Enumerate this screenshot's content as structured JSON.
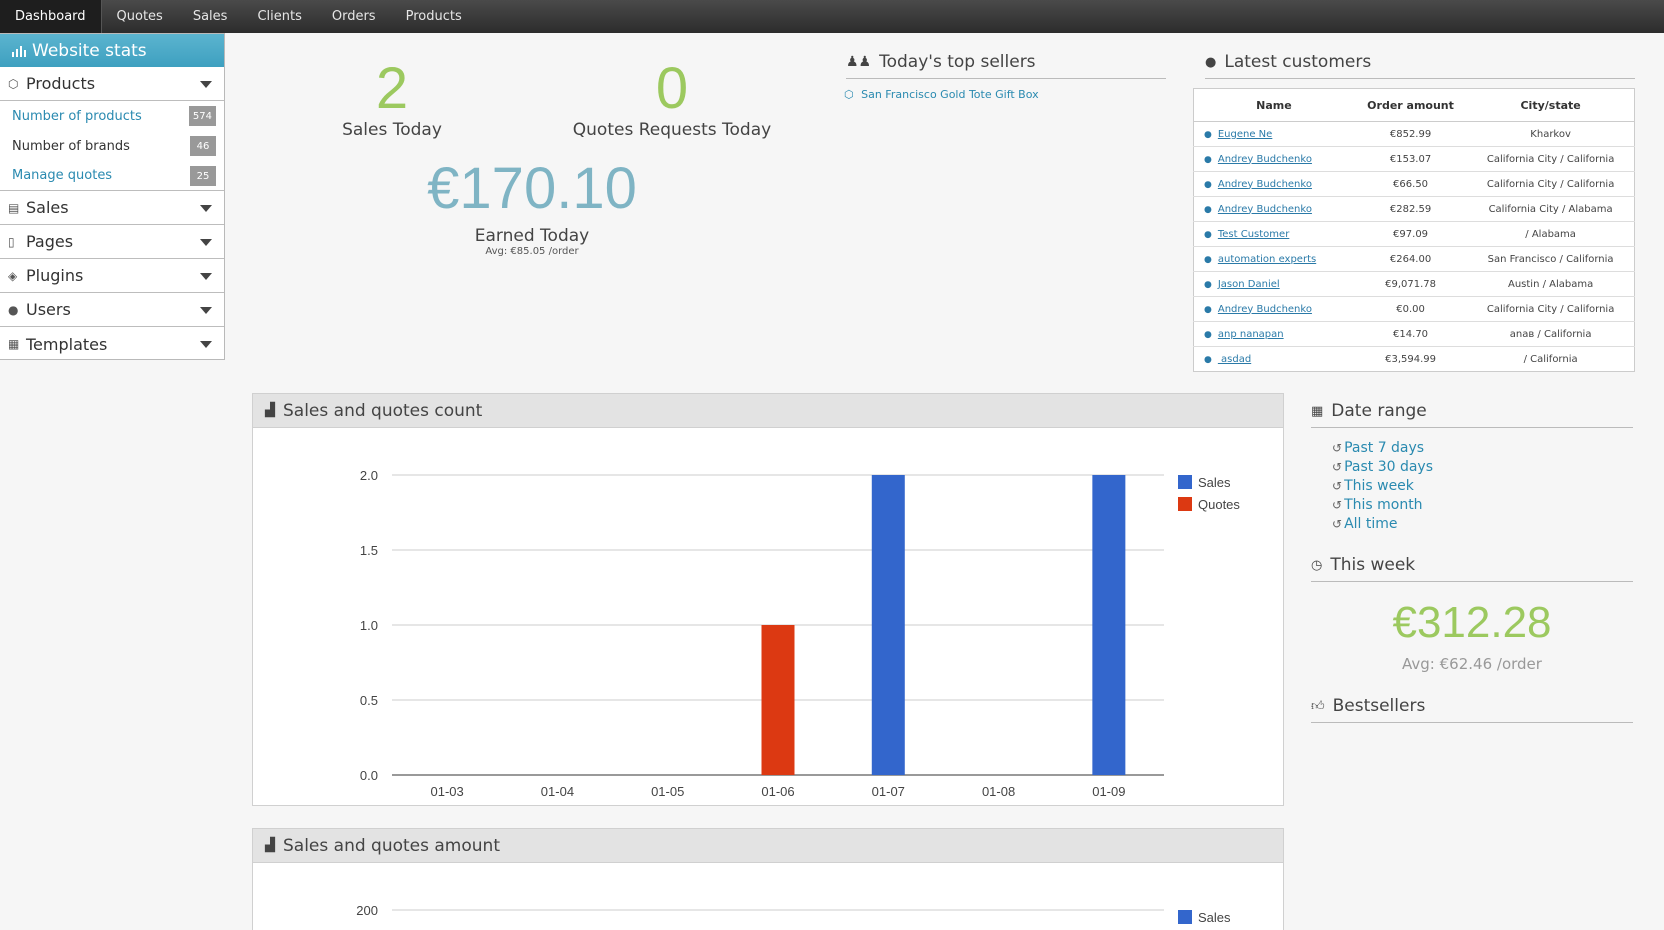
{
  "topnav": {
    "items": [
      "Dashboard",
      "Quotes",
      "Sales",
      "Clients",
      "Orders",
      "Products"
    ]
  },
  "sidebar": {
    "title": "Website stats",
    "products": {
      "label": "Products",
      "subitems": [
        {
          "label": "Number of products",
          "count": "574"
        },
        {
          "label": "Number of brands",
          "count": "46"
        },
        {
          "label": "Manage quotes",
          "count": "25"
        }
      ]
    },
    "sections": [
      "Sales",
      "Pages",
      "Plugins",
      "Users",
      "Templates"
    ]
  },
  "stats": {
    "sales_today": "2",
    "sales_today_label": "Sales Today",
    "quotes_today": "0",
    "quotes_today_label": "Quotes Requests Today",
    "earned": "€170.10",
    "earned_label": "Earned Today",
    "earned_avg": "Avg: €85.05 /order"
  },
  "top_sellers": {
    "title": "Today's top sellers",
    "items": [
      "San Francisco Gold Tote Gift Box"
    ]
  },
  "latest_customers": {
    "title": "Latest customers",
    "columns": [
      "Name",
      "Order amount",
      "City/state"
    ],
    "rows": [
      [
        "Eugene Ne",
        "€852.99",
        "Kharkov"
      ],
      [
        "Andrey Budchenko",
        "€153.07",
        "California City / California"
      ],
      [
        "Andrey Budchenko",
        "€66.50",
        "California City / California"
      ],
      [
        "Andrey Budchenko",
        "€282.59",
        "California City / Alabama"
      ],
      [
        "Test Customer",
        "€97.09",
        " / Alabama"
      ],
      [
        "automation experts",
        "€264.00",
        "San Francisco / California"
      ],
      [
        "Jason Daniel",
        "€9,071.78",
        "Austin / Alabama"
      ],
      [
        "Andrey Budchenko",
        "€0.00",
        "California City / California"
      ],
      [
        "anp nanapan",
        "€14.70",
        "anaв / California"
      ],
      [
        " asdad",
        "€3,594.99",
        " / California"
      ]
    ]
  },
  "charts": {
    "count_title": "Sales and quotes count",
    "amount_title": "Sales and quotes amount"
  },
  "chart_data": [
    {
      "type": "bar",
      "title": "Sales and quotes count",
      "categories": [
        "01-03",
        "01-04",
        "01-05",
        "01-06",
        "01-07",
        "01-08",
        "01-09"
      ],
      "series": [
        {
          "name": "Sales",
          "color": "#3366cc",
          "values": [
            0,
            0,
            0,
            0,
            2,
            0,
            2
          ]
        },
        {
          "name": "Quotes",
          "color": "#dc3912",
          "values": [
            0,
            0,
            0,
            1,
            0,
            0,
            0
          ]
        }
      ],
      "ylim": [
        0,
        2
      ],
      "yticks": [
        "0.0",
        "0.5",
        "1.0",
        "1.5",
        "2.0"
      ],
      "legend": "right",
      "grid": true
    },
    {
      "type": "bar",
      "title": "Sales and quotes amount",
      "series": [
        {
          "name": "Sales",
          "color": "#3366cc"
        }
      ],
      "yticks": [
        "200"
      ],
      "legend": "right",
      "grid": true
    }
  ],
  "right": {
    "date_range_title": "Date range",
    "ranges": [
      "Past 7 days",
      "Past 30 days",
      "This week",
      "This month",
      "All time"
    ],
    "this_week_title": "This week",
    "week_amount": "€312.28",
    "week_avg": "Avg: €62.46 /order",
    "bestsellers_title": "Bestsellers"
  }
}
